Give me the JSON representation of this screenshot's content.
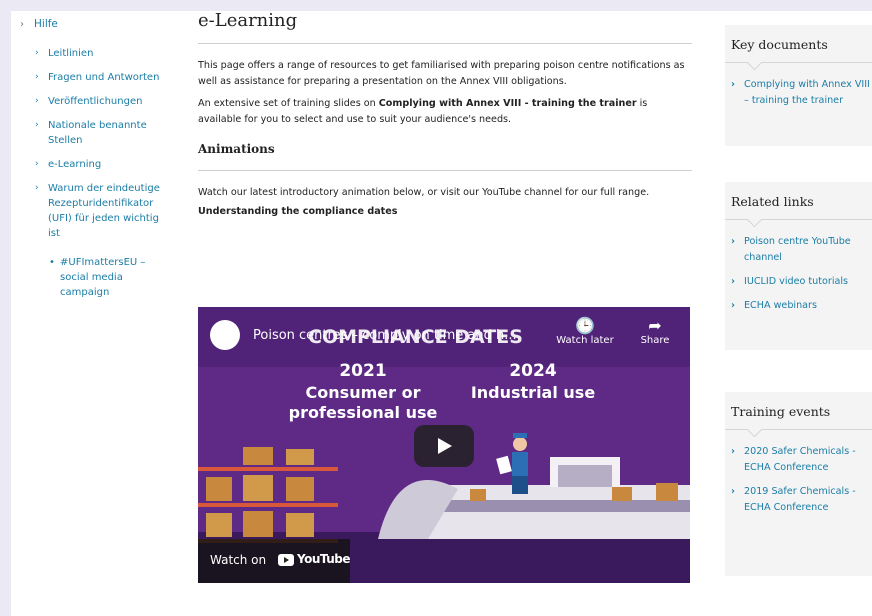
{
  "leftnav": {
    "root": "Hilfe",
    "items": [
      "Leitlinien",
      "Fragen und Antworten",
      "Veröffentlichungen",
      "Nationale benannte Stellen",
      "e-Learning",
      "Warum der eindeutige Rezepturidentifikator (UFI) für jeden wichtig ist"
    ],
    "sub_items": [
      "#UFImattersEU – social media campaign"
    ]
  },
  "main": {
    "title": "e-Learning",
    "intro": "This page offers a range of resources to get familiarised with preparing poison centre notifications as well as assistance for preparing a presentation on the Annex VIII obligations.",
    "slides_pre": "An extensive set of training slides on ",
    "slides_bold": "Complying with Annex VIII - training the trainer",
    "slides_post": " is available for you to select and use to suit your audience's needs.",
    "section_title": "Animations",
    "animation_text": "Watch our latest introductory animation below, or visit our YouTube channel for our full range.",
    "video_caption": "Understanding the compliance dates"
  },
  "video": {
    "title": "Poison centres – comply on time and h...",
    "overlay_heading": "COMPLIANCE DATES",
    "watch_later": "Watch later",
    "share": "Share",
    "year_left": "2021",
    "label_left_1": "Consumer or",
    "label_left_2": "professional use",
    "year_right": "2024",
    "label_right": "Industrial use",
    "watch_on": "Watch on",
    "youtube": "YouTube",
    "colors": {
      "background": "#5e2a85",
      "floor": "#3a1a5c"
    }
  },
  "key_documents": {
    "title": "Key documents",
    "links": [
      "Complying with Annex VIII – training the trainer"
    ]
  },
  "related_links": {
    "title": "Related links",
    "links": [
      "Poison centre YouTube channel",
      "IUCLID video tutorials",
      "ECHA webinars"
    ]
  },
  "training_events": {
    "title": "Training events",
    "links": [
      "2020 Safer Chemicals - ECHA Conference",
      "2019 Safer Chemicals - ECHA Conference"
    ]
  },
  "colors": {
    "link": "#1b7da6",
    "page_bg": "#ebe9f4"
  }
}
